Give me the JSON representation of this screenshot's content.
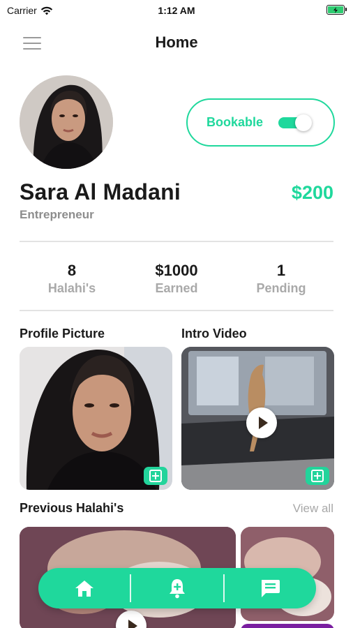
{
  "status_bar": {
    "carrier": "Carrier",
    "time": "1:12 AM"
  },
  "header": {
    "title": "Home"
  },
  "profile": {
    "name": "Sara Al Madani",
    "role": "Entrepreneur",
    "price": "$200",
    "bookable_label": "Bookable",
    "bookable_on": true
  },
  "stats": [
    {
      "value": "8",
      "label": "Halahi's"
    },
    {
      "value": "$1000",
      "label": "Earned"
    },
    {
      "value": "1",
      "label": "Pending"
    }
  ],
  "sections": {
    "profile_picture": "Profile Picture",
    "intro_video": "Intro Video",
    "previous_halahis": "Previous Halahi's",
    "view_all": "View all"
  },
  "colors": {
    "accent": "#1fd89c",
    "muted_text": "#a9a9a9"
  },
  "icons": {
    "menu": "hamburger-menu-icon",
    "home": "home-icon",
    "notifications": "bell-plus-icon",
    "messages": "chat-icon"
  }
}
